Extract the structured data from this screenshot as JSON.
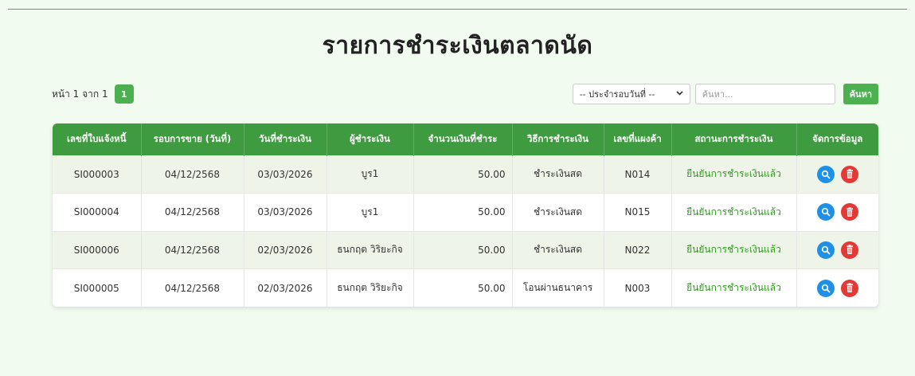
{
  "page": {
    "title": "รายการชำระเงินตลาดนัด"
  },
  "pagination": {
    "text": "หน้า 1 จาก 1",
    "current_page": "1"
  },
  "filters": {
    "period_select_value": "-- ประจำรอบวันที่ --",
    "search_placeholder": "ค้นหา...",
    "search_button": "ค้นหา"
  },
  "table": {
    "headers": [
      "เลขที่ใบแจ้งหนี้",
      "รอบการขาย (วันที่)",
      "วันที่ชำระเงิน",
      "ผู้ชำระเงิน",
      "จำนวนเงินที่ชำระ",
      "วิธีการชำระเงิน",
      "เลขที่แผงค้า",
      "สถานะการชำระเงิน",
      "จัดการข้อมูล"
    ],
    "rows": [
      {
        "invoice": "SI000003",
        "round": "04/12/2568",
        "paid_date": "03/03/2026",
        "payer": "บูร1",
        "amount": "50.00",
        "method": "ชำระเงินสด",
        "stall": "N014",
        "status": "ยืนยันการชำระเงินแล้ว"
      },
      {
        "invoice": "SI000004",
        "round": "04/12/2568",
        "paid_date": "03/03/2026",
        "payer": "บูร1",
        "amount": "50.00",
        "method": "ชำระเงินสด",
        "stall": "N015",
        "status": "ยืนยันการชำระเงินแล้ว"
      },
      {
        "invoice": "SI000006",
        "round": "04/12/2568",
        "paid_date": "02/03/2026",
        "payer": "ธนกฤต วิริยะกิจ",
        "amount": "50.00",
        "method": "ชำระเงินสด",
        "stall": "N022",
        "status": "ยืนยันการชำระเงินแล้ว"
      },
      {
        "invoice": "SI000005",
        "round": "04/12/2568",
        "paid_date": "02/03/2026",
        "payer": "ธนกฤต วิริยะกิจ",
        "amount": "50.00",
        "method": "โอนผ่านธนาคาร",
        "stall": "N003",
        "status": "ยืนยันการชำระเงินแล้ว"
      }
    ]
  },
  "colors": {
    "header_green": "#3f9b3f",
    "button_green": "#4caf50",
    "status_green": "#2e9a1e",
    "view_blue": "#1e90e8",
    "delete_red": "#e53935",
    "page_bg": "#f2fbf0"
  },
  "icons": {
    "view": "magnifier-icon",
    "delete": "trash-icon"
  }
}
